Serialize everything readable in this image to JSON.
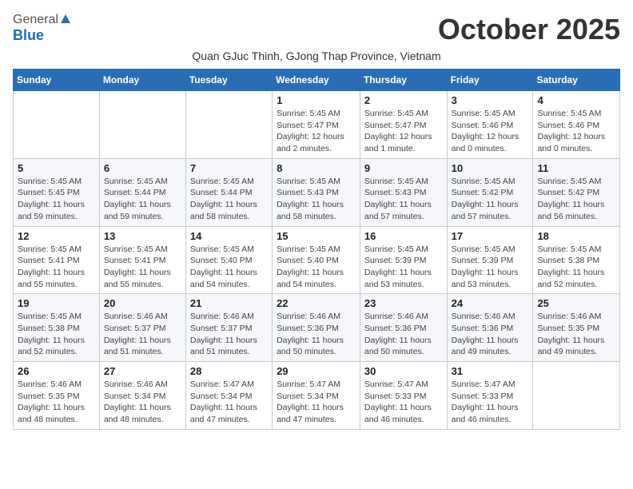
{
  "logo": {
    "general": "General",
    "blue": "Blue"
  },
  "title": "October 2025",
  "subtitle": "Quan GJuc Thinh, GJong Thap Province, Vietnam",
  "days_of_week": [
    "Sunday",
    "Monday",
    "Tuesday",
    "Wednesday",
    "Thursday",
    "Friday",
    "Saturday"
  ],
  "weeks": [
    [
      {
        "day": "",
        "info": ""
      },
      {
        "day": "",
        "info": ""
      },
      {
        "day": "",
        "info": ""
      },
      {
        "day": "1",
        "info": "Sunrise: 5:45 AM\nSunset: 5:47 PM\nDaylight: 12 hours\nand 2 minutes."
      },
      {
        "day": "2",
        "info": "Sunrise: 5:45 AM\nSunset: 5:47 PM\nDaylight: 12 hours\nand 1 minute."
      },
      {
        "day": "3",
        "info": "Sunrise: 5:45 AM\nSunset: 5:46 PM\nDaylight: 12 hours\nand 0 minutes."
      },
      {
        "day": "4",
        "info": "Sunrise: 5:45 AM\nSunset: 5:46 PM\nDaylight: 12 hours\nand 0 minutes."
      }
    ],
    [
      {
        "day": "5",
        "info": "Sunrise: 5:45 AM\nSunset: 5:45 PM\nDaylight: 11 hours\nand 59 minutes."
      },
      {
        "day": "6",
        "info": "Sunrise: 5:45 AM\nSunset: 5:44 PM\nDaylight: 11 hours\nand 59 minutes."
      },
      {
        "day": "7",
        "info": "Sunrise: 5:45 AM\nSunset: 5:44 PM\nDaylight: 11 hours\nand 58 minutes."
      },
      {
        "day": "8",
        "info": "Sunrise: 5:45 AM\nSunset: 5:43 PM\nDaylight: 11 hours\nand 58 minutes."
      },
      {
        "day": "9",
        "info": "Sunrise: 5:45 AM\nSunset: 5:43 PM\nDaylight: 11 hours\nand 57 minutes."
      },
      {
        "day": "10",
        "info": "Sunrise: 5:45 AM\nSunset: 5:42 PM\nDaylight: 11 hours\nand 57 minutes."
      },
      {
        "day": "11",
        "info": "Sunrise: 5:45 AM\nSunset: 5:42 PM\nDaylight: 11 hours\nand 56 minutes."
      }
    ],
    [
      {
        "day": "12",
        "info": "Sunrise: 5:45 AM\nSunset: 5:41 PM\nDaylight: 11 hours\nand 55 minutes."
      },
      {
        "day": "13",
        "info": "Sunrise: 5:45 AM\nSunset: 5:41 PM\nDaylight: 11 hours\nand 55 minutes."
      },
      {
        "day": "14",
        "info": "Sunrise: 5:45 AM\nSunset: 5:40 PM\nDaylight: 11 hours\nand 54 minutes."
      },
      {
        "day": "15",
        "info": "Sunrise: 5:45 AM\nSunset: 5:40 PM\nDaylight: 11 hours\nand 54 minutes."
      },
      {
        "day": "16",
        "info": "Sunrise: 5:45 AM\nSunset: 5:39 PM\nDaylight: 11 hours\nand 53 minutes."
      },
      {
        "day": "17",
        "info": "Sunrise: 5:45 AM\nSunset: 5:39 PM\nDaylight: 11 hours\nand 53 minutes."
      },
      {
        "day": "18",
        "info": "Sunrise: 5:45 AM\nSunset: 5:38 PM\nDaylight: 11 hours\nand 52 minutes."
      }
    ],
    [
      {
        "day": "19",
        "info": "Sunrise: 5:45 AM\nSunset: 5:38 PM\nDaylight: 11 hours\nand 52 minutes."
      },
      {
        "day": "20",
        "info": "Sunrise: 5:46 AM\nSunset: 5:37 PM\nDaylight: 11 hours\nand 51 minutes."
      },
      {
        "day": "21",
        "info": "Sunrise: 5:46 AM\nSunset: 5:37 PM\nDaylight: 11 hours\nand 51 minutes."
      },
      {
        "day": "22",
        "info": "Sunrise: 5:46 AM\nSunset: 5:36 PM\nDaylight: 11 hours\nand 50 minutes."
      },
      {
        "day": "23",
        "info": "Sunrise: 5:46 AM\nSunset: 5:36 PM\nDaylight: 11 hours\nand 50 minutes."
      },
      {
        "day": "24",
        "info": "Sunrise: 5:46 AM\nSunset: 5:36 PM\nDaylight: 11 hours\nand 49 minutes."
      },
      {
        "day": "25",
        "info": "Sunrise: 5:46 AM\nSunset: 5:35 PM\nDaylight: 11 hours\nand 49 minutes."
      }
    ],
    [
      {
        "day": "26",
        "info": "Sunrise: 5:46 AM\nSunset: 5:35 PM\nDaylight: 11 hours\nand 48 minutes."
      },
      {
        "day": "27",
        "info": "Sunrise: 5:46 AM\nSunset: 5:34 PM\nDaylight: 11 hours\nand 48 minutes."
      },
      {
        "day": "28",
        "info": "Sunrise: 5:47 AM\nSunset: 5:34 PM\nDaylight: 11 hours\nand 47 minutes."
      },
      {
        "day": "29",
        "info": "Sunrise: 5:47 AM\nSunset: 5:34 PM\nDaylight: 11 hours\nand 47 minutes."
      },
      {
        "day": "30",
        "info": "Sunrise: 5:47 AM\nSunset: 5:33 PM\nDaylight: 11 hours\nand 46 minutes."
      },
      {
        "day": "31",
        "info": "Sunrise: 5:47 AM\nSunset: 5:33 PM\nDaylight: 11 hours\nand 46 minutes."
      },
      {
        "day": "",
        "info": ""
      }
    ]
  ]
}
